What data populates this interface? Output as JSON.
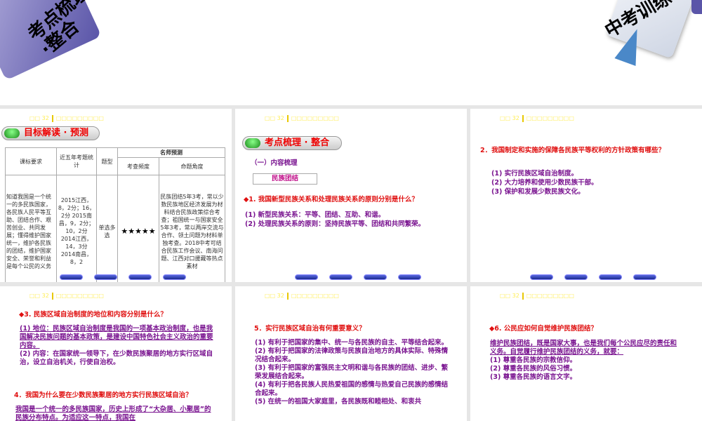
{
  "top_slide": {
    "left_banner": "考点梳理·整合",
    "right_banner": "中考训练"
  },
  "header": {
    "lesson": "□□ 32",
    "title": "□□□□□□□□□"
  },
  "slide1": {
    "pill": "目标解读 · 预测",
    "table": {
      "col1": "课标要求",
      "col2": "近五年考题统计",
      "col3": "题型",
      "group": "名师预测",
      "col4": "考查频度",
      "col5": "命题角度",
      "req": "知道我国是一个统一的多民族国家，各民族人民平等互助、团结合作、艰苦创业、共同发展；懂得维护国家统一，维护各民族的团结，维护国家安全、荣誉和利益是每个公民的义务",
      "stats": "2015江西，8，2分；16，2分 2015南昌，9，2分；10，2分 2014江西，14，3分 2014南昌，8，2",
      "type": "单选多选",
      "freq": "★★★★★",
      "angle": "民族团结5年3考，常以少数民族地区经济发展为材料结合民族政策综合考查；祖国统一与国家安全5年3考，常以两岸交流与合作、领土问题为材料单独考查。2018中考可结合民族工作会议、南海问题、江西对口援藏等热点素材"
    }
  },
  "slide2": {
    "pill": "考点梳理 · 整合",
    "section": "（一）内容梳理",
    "box": "民族团结",
    "q": "◆1. 我国新型民族关系和处理民族关系的原则分别是什么？",
    "a1": "(1) 新型民族关系：平等、团结、互助、和谐。",
    "a2": "(2) 处理民族关系的原则：坚持民族平等、团结和共同繁荣。"
  },
  "slide3": {
    "q": "2．我国制定和实施的保障各民族平等权利的方针政策有哪些？",
    "a1": "(1) 实行民族区域自治制度。",
    "a2": "(2) 大力培养和使用少数民族干部。",
    "a3": "(3) 保护和发展少数民族文化。"
  },
  "slide4": {
    "q": "◆3. 民族区域自治制度的地位和内容分别是什么？",
    "a1": "(1) 地位：民族区域自治制度是我国的一项基本政治制度，也是我国解决民族问题的基本政策，是建设中国特色社会主义政治的重要内容。",
    "a2": "(2) 内容：在国家统一领导下，在少数民族聚居的地方实行区域自治，设立自治机关，行使自治权。",
    "q2": "4．我国为什么要在少数民族聚居的地方实行民族区域自治？",
    "a3": "我国是一个统一的多民族国家，历史上形成了“大杂居、小聚居”的民族分布特点。为适应这一特点，我国在"
  },
  "slide5": {
    "q": "5．实行民族区域自治有何重要意义？",
    "a1": "(1) 有利于把国家的集中、统一与各民族的自主、平等结合起来。",
    "a2": "(2) 有利于把国家的法律政策与民族自治地方的具体实际、特殊情况结合起来。",
    "a3": "(3) 有利于把国家的富强民主文明和谐与各民族的团结、进步、繁荣发展结合起来。",
    "a4": "(4) 有利于把各民族人民热爱祖国的感情与热爱自己民族的感情结合起来。",
    "a5": "(5) 在统一的祖国大家庭里，各民族既和睦相处、和衷共"
  },
  "slide6": {
    "q": "◆6. 公民应如何自觉维护民族团结？",
    "a0": "维护民族团结，既是国家大事，也是我们每个公民应尽的责任和义务。自觉履行维护民族团结的义务，就要：",
    "a1": "(1) 尊重各民族的宗教信仰。",
    "a2": "(2) 尊重各民族的风俗习惯。",
    "a3": "(3) 尊重各民族的语言文字。"
  }
}
